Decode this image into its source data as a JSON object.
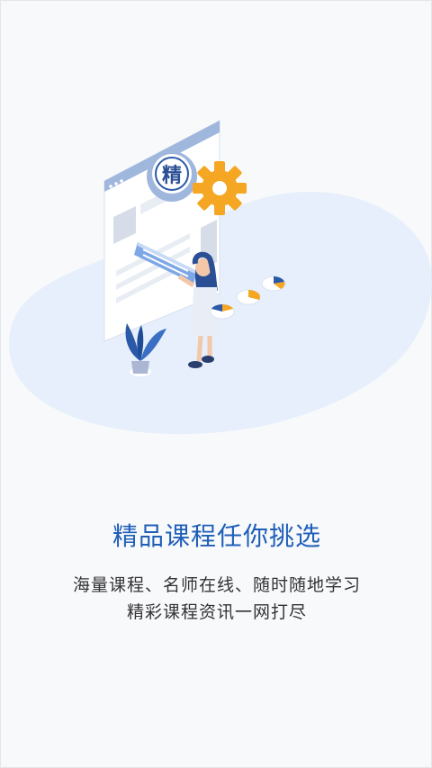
{
  "onboarding": {
    "badge_char": "精",
    "title": "精品课程任你挑选",
    "subtitle_line1": "海量课程、名师在线、随时随地学习",
    "subtitle_line2": "精彩课程资讯一网打尽"
  },
  "icons": {
    "badge": "jing-badge-icon",
    "gear": "gear-icon",
    "plant": "plant-icon",
    "pie": "pie-chart-icon"
  },
  "colors": {
    "brand": "#1f5fb8",
    "accent_orange": "#f5a623",
    "blob": "#e6effb"
  }
}
